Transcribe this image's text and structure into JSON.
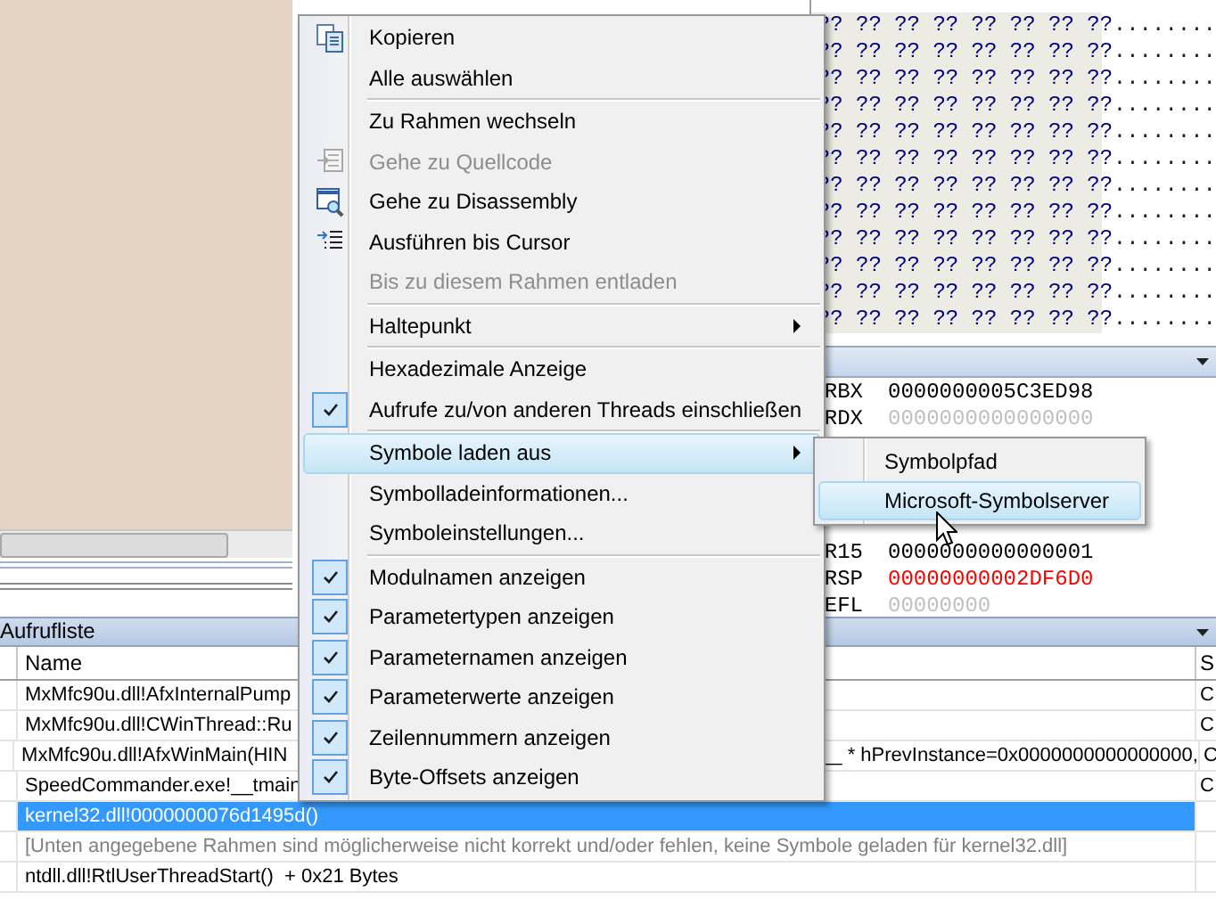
{
  "memory": {
    "rows": [
      {
        "hex": "?? ?? ?? ?? ?? ?? ?? ??",
        "ascii": "........"
      },
      {
        "hex": "?? ?? ?? ?? ?? ?? ?? ??",
        "ascii": "........"
      },
      {
        "hex": "?? ?? ?? ?? ?? ?? ?? ??",
        "ascii": "........"
      },
      {
        "hex": "?? ?? ?? ?? ?? ?? ?? ??",
        "ascii": "........"
      },
      {
        "hex": "?? ?? ?? ?? ?? ?? ?? ??",
        "ascii": "........"
      },
      {
        "hex": "?? ?? ?? ?? ?? ?? ?? ??",
        "ascii": "........"
      },
      {
        "hex": "?? ?? ?? ?? ?? ?? ?? ??",
        "ascii": "........"
      },
      {
        "hex": "?? ?? ?? ?? ?? ?? ?? ??",
        "ascii": "........"
      },
      {
        "hex": "?? ?? ?? ?? ?? ?? ?? ??",
        "ascii": "........"
      },
      {
        "hex": "?? ?? ?? ?? ?? ?? ?? ??",
        "ascii": "........"
      },
      {
        "hex": "?? ?? ?? ?? ?? ?? ?? ??",
        "ascii": "........"
      },
      {
        "hex": "?? ?? ?? ?? ?? ?? ?? ??",
        "ascii": "........"
      }
    ]
  },
  "registers": [
    {
      "name": "RBX",
      "value": "0000000005C3ED98",
      "color": "#000000"
    },
    {
      "name": "RDX",
      "value": "0000000000000000",
      "color": "#c0c0c0"
    },
    {
      "name": "R15",
      "value": "0000000000000001",
      "color": "#000000"
    },
    {
      "name": "RSP",
      "value": "00000000002DF6D0",
      "color": "#ff0000"
    },
    {
      "name": "EFL",
      "value": "00000000",
      "color": "#c0c0c0"
    }
  ],
  "call_stack": {
    "title": "Aufrufliste",
    "columns": [
      "Name",
      "S"
    ],
    "rows": [
      {
        "kind": "frame",
        "name": "MxMfc90u.dll!AfxInternalPump",
        "language": "C",
        "selected": false
      },
      {
        "kind": "frame",
        "name": "MxMfc90u.dll!CWinThread::Ru",
        "language": "C",
        "selected": false
      },
      {
        "kind": "frame",
        "name": "MxMfc90u.dll!AfxWinMain(HIN",
        "name_tail": "__ * hPrevInstance=0x0000000000000000,",
        "language": "C",
        "selected": false
      },
      {
        "kind": "frame",
        "name": "SpeedCommander.exe!__tmain",
        "language": "C",
        "selected": false
      },
      {
        "kind": "frame",
        "name": "kernel32.dll!0000000076d1495d()",
        "selected": true
      },
      {
        "kind": "note",
        "name": "[Unten angegebene Rahmen sind möglicherweise nicht korrekt und/oder fehlen, keine Symbole geladen für kernel32.dll]",
        "selected": false
      },
      {
        "kind": "frame",
        "name": "ntdll.dll!RtlUserThreadStart()  + 0x21 Bytes",
        "selected": false
      }
    ]
  },
  "context_menu": {
    "items": [
      {
        "kind": "item",
        "label": "Kopieren",
        "disabled": false,
        "checked": false,
        "submenu": false,
        "selected": false
      },
      {
        "kind": "item",
        "label": "Alle auswählen",
        "disabled": false,
        "checked": false,
        "submenu": false,
        "selected": false
      },
      {
        "kind": "separator"
      },
      {
        "kind": "item",
        "label": "Zu Rahmen wechseln",
        "disabled": false,
        "checked": false,
        "submenu": false,
        "selected": false
      },
      {
        "kind": "item",
        "label": "Gehe zu Quellcode",
        "disabled": true,
        "checked": false,
        "submenu": false,
        "selected": false
      },
      {
        "kind": "item",
        "label": "Gehe zu Disassembly",
        "disabled": false,
        "checked": false,
        "submenu": false,
        "selected": false
      },
      {
        "kind": "item",
        "label": "Ausführen bis Cursor",
        "disabled": false,
        "checked": false,
        "submenu": false,
        "selected": false
      },
      {
        "kind": "item",
        "label": "Bis zu diesem Rahmen entladen",
        "disabled": true,
        "checked": false,
        "submenu": false,
        "selected": false
      },
      {
        "kind": "separator"
      },
      {
        "kind": "item",
        "label": "Haltepunkt",
        "disabled": false,
        "checked": false,
        "submenu": true,
        "selected": false
      },
      {
        "kind": "separator"
      },
      {
        "kind": "item",
        "label": "Hexadezimale Anzeige",
        "disabled": false,
        "checked": false,
        "submenu": false,
        "selected": false
      },
      {
        "kind": "item",
        "label": "Aufrufe zu/von anderen Threads einschließen",
        "disabled": false,
        "checked": true,
        "submenu": false,
        "selected": false
      },
      {
        "kind": "separator"
      },
      {
        "kind": "item",
        "label": "Symbole laden aus",
        "disabled": false,
        "checked": false,
        "submenu": true,
        "selected": true
      },
      {
        "kind": "item",
        "label": "Symbolladeinformationen...",
        "disabled": false,
        "checked": false,
        "submenu": false,
        "selected": false
      },
      {
        "kind": "item",
        "label": "Symboleinstellungen...",
        "disabled": false,
        "checked": false,
        "submenu": false,
        "selected": false
      },
      {
        "kind": "separator"
      },
      {
        "kind": "item",
        "label": "Modulnamen anzeigen",
        "disabled": false,
        "checked": true,
        "submenu": false,
        "selected": false
      },
      {
        "kind": "item",
        "label": "Parametertypen anzeigen",
        "disabled": false,
        "checked": true,
        "submenu": false,
        "selected": false
      },
      {
        "kind": "item",
        "label": "Parameternamen anzeigen",
        "disabled": false,
        "checked": true,
        "submenu": false,
        "selected": false
      },
      {
        "kind": "item",
        "label": "Parameterwerte anzeigen",
        "disabled": false,
        "checked": true,
        "submenu": false,
        "selected": false
      },
      {
        "kind": "item",
        "label": "Zeilennummern anzeigen",
        "disabled": false,
        "checked": true,
        "submenu": false,
        "selected": false
      },
      {
        "kind": "item",
        "label": "Byte-Offsets anzeigen",
        "disabled": false,
        "checked": true,
        "submenu": false,
        "selected": false
      }
    ]
  },
  "submenu": {
    "items": [
      {
        "label": "Symbolpfad",
        "selected": false
      },
      {
        "label": "Microsoft-Symbolserver",
        "selected": true
      }
    ]
  }
}
